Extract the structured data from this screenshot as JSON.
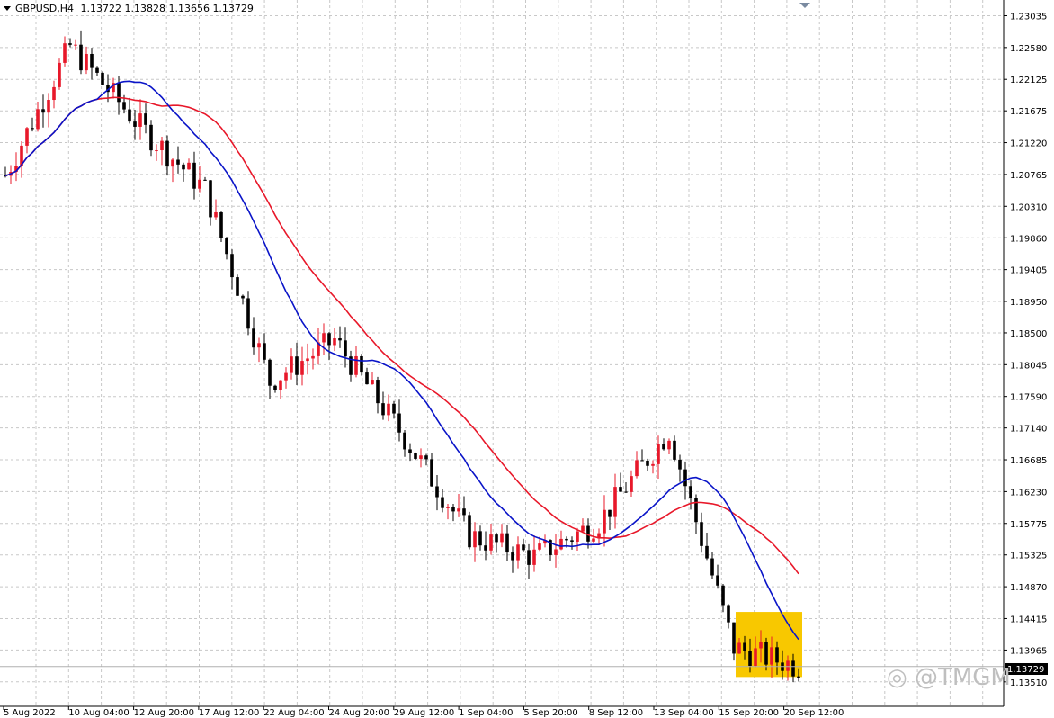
{
  "header": {
    "symbol": "GBPUSD,H4",
    "ohlc": "1.13722 1.13828 1.13656 1.13729"
  },
  "watermark": "@TMGM",
  "current_price_label": "1.13729",
  "colors": {
    "bull": "#e8182a",
    "bear": "#000000",
    "ma_fast": "#0a14c8",
    "ma_slow": "#e8182a",
    "highlight": "#f8c800",
    "grid": "#c8c8c8"
  },
  "chart_data": {
    "type": "candlestick",
    "symbol": "GBPUSD",
    "timeframe": "H4",
    "ylim": [
      1.1316,
      1.2326
    ],
    "yticks": [
      "1.23035",
      "1.22580",
      "1.22125",
      "1.21675",
      "1.21220",
      "1.20765",
      "1.20310",
      "1.19860",
      "1.19405",
      "1.18950",
      "1.18500",
      "1.18045",
      "1.17590",
      "1.17140",
      "1.16685",
      "1.16230",
      "1.15775",
      "1.15325",
      "1.14870",
      "1.14415",
      "1.13965",
      "1.13510"
    ],
    "xticks": [
      "5 Aug 2022",
      "10 Aug 04:00",
      "12 Aug 20:00",
      "17 Aug 12:00",
      "22 Aug 04:00",
      "24 Aug 20:00",
      "29 Aug 12:00",
      "1 Sep 04:00",
      "5 Sep 20:00",
      "8 Sep 12:00",
      "13 Sep 04:00",
      "15 Sep 20:00",
      "20 Sep 12:00"
    ],
    "grid": true,
    "highlight_zone": {
      "from_bar": 136,
      "to_bar": 147,
      "price_low": 1.1358,
      "price_high": 1.1451
    },
    "key_closes": [
      {
        "date": "5 Aug 2022",
        "price": 1.2075
      },
      {
        "date": "10 Aug 04:00",
        "price": 1.226
      },
      {
        "date": "12 Aug 20:00",
        "price": 1.2145
      },
      {
        "date": "17 Aug 12:00",
        "price": 1.2055
      },
      {
        "date": "22 Aug 04:00",
        "price": 1.178
      },
      {
        "date": "24 Aug 20:00",
        "price": 1.184
      },
      {
        "date": "29 Aug 12:00",
        "price": 1.17
      },
      {
        "date": "1 Sep 04:00",
        "price": 1.156
      },
      {
        "date": "5 Sep 20:00",
        "price": 1.153
      },
      {
        "date": "8 Sep 12:00",
        "price": 1.158
      },
      {
        "date": "13 Sep 04:00",
        "price": 1.171
      },
      {
        "date": "15 Sep 20:00",
        "price": 1.14
      },
      {
        "date": "20 Sep 12:00",
        "price": 1.1373
      }
    ],
    "series": [
      {
        "values_ma_fast": [
          1.213,
          1.212,
          1.215,
          1.214,
          1.205,
          1.187,
          1.177,
          1.172,
          1.164,
          1.155,
          1.154,
          1.152,
          1.153,
          1.153,
          1.157,
          1.159,
          1.1548,
          1.1479
        ]
      },
      {
        "values_ma_slow": [
          1.209,
          1.21,
          1.212,
          1.2095,
          1.208,
          1.2,
          1.19,
          1.185,
          1.178,
          1.168,
          1.168,
          1.1662,
          1.162,
          1.157,
          1.154
        ]
      }
    ]
  }
}
